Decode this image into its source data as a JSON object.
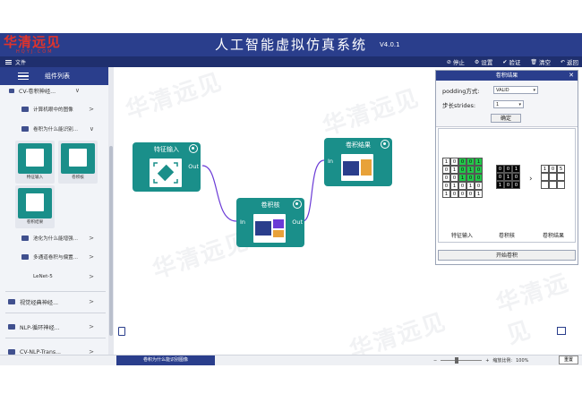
{
  "app": {
    "logo_main": "华清远见",
    "logo_sub": "HQYJ.COM",
    "title": "人工智能虚拟仿真系统",
    "version": "V4.0.1"
  },
  "menubar": {
    "file_label": "文件",
    "toolbar": [
      {
        "icon": "stop-icon",
        "glyph": "⊘",
        "label": "停止"
      },
      {
        "icon": "settings-icon",
        "glyph": "⚙",
        "label": "设置"
      },
      {
        "icon": "verify-icon",
        "glyph": "✔",
        "label": "验证"
      },
      {
        "icon": "clear-icon",
        "glyph": "🗑",
        "label": "清空"
      },
      {
        "icon": "back-icon",
        "glyph": "↶",
        "label": "返回"
      }
    ]
  },
  "sidebar": {
    "header": "组件列表",
    "items": [
      {
        "label": "CV-卷积神经...",
        "arrow": "∨"
      },
      {
        "label": "计算机眼中的图像",
        "arrow": ">"
      },
      {
        "label": "卷积为什么能识别...",
        "arrow": "∨"
      },
      {
        "label": "池化为什么能增强...",
        "arrow": ">"
      },
      {
        "label": "多通道卷积与偏置...",
        "arrow": ">"
      },
      {
        "label": "LeNet-5",
        "arrow": ">"
      },
      {
        "label": "视觉经典神经...",
        "arrow": ">"
      },
      {
        "label": "NLP-循环神经...",
        "arrow": ">"
      },
      {
        "label": "CV-NLP-Trans...",
        "arrow": ">"
      }
    ],
    "tiles": [
      {
        "label": "特征输入"
      },
      {
        "label": "卷积核"
      },
      {
        "label": "卷积结果"
      }
    ]
  },
  "canvas": {
    "watermark": "华清远见",
    "nodes": {
      "input": {
        "title": "特征输入",
        "out": "Out"
      },
      "kernel": {
        "title": "卷积核",
        "in": "In",
        "out": "Out"
      },
      "result": {
        "title": "卷积结果",
        "in": "In"
      }
    },
    "tab_label": "卷积为什么能识别图像"
  },
  "conv_panel": {
    "title": "卷积结果",
    "padding_label": "podding方式:",
    "padding_value": "VALID",
    "stride_label": "步长strides:",
    "stride_value": "1",
    "confirm": "确定",
    "input_matrix": [
      [
        1,
        0,
        0,
        0,
        1
      ],
      [
        0,
        1,
        0,
        1,
        0
      ],
      [
        0,
        0,
        1,
        0,
        0
      ],
      [
        0,
        1,
        0,
        1,
        0
      ],
      [
        1,
        0,
        0,
        0,
        1
      ]
    ],
    "kernel_matrix": [
      [
        0,
        0,
        1
      ],
      [
        0,
        1,
        0
      ],
      [
        1,
        0,
        0
      ]
    ],
    "result_row": [
      "1",
      "0",
      "5"
    ],
    "label_input": "特征输入",
    "label_kernel": "卷积核",
    "label_result": "卷积结果",
    "start_button": "开始卷积"
  },
  "statusbar": {
    "zoom_label": "缩放比例:",
    "zoom_value": "100%",
    "reset": "重置"
  }
}
